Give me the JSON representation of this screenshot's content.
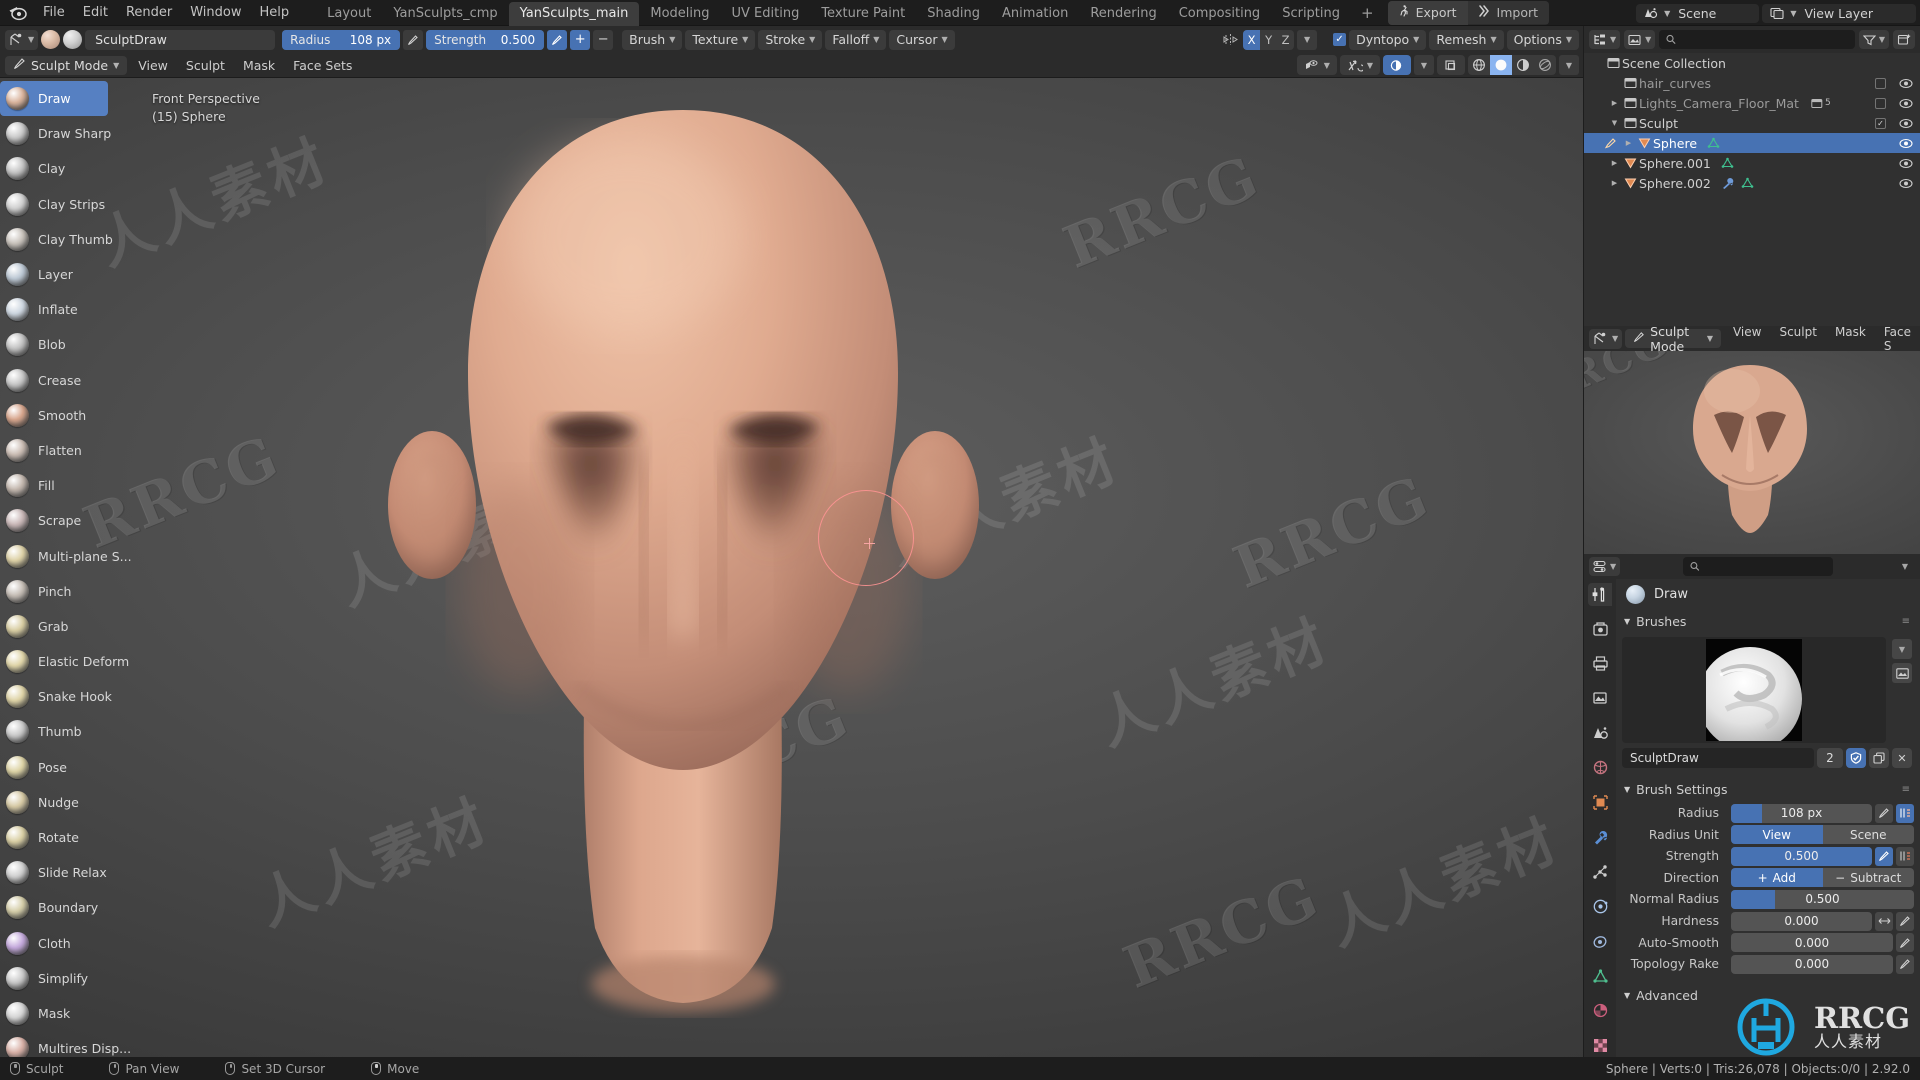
{
  "app": {
    "name": "Blender",
    "version": "2.92.0"
  },
  "topbar": {
    "menus": [
      "File",
      "Edit",
      "Render",
      "Window",
      "Help"
    ],
    "workspaces": [
      {
        "label": "Layout",
        "active": false
      },
      {
        "label": "YanSculpts_cmp",
        "active": false
      },
      {
        "label": "YanSculpts_main",
        "active": true
      },
      {
        "label": "Modeling",
        "active": false
      },
      {
        "label": "UV Editing",
        "active": false
      },
      {
        "label": "Texture Paint",
        "active": false
      },
      {
        "label": "Shading",
        "active": false
      },
      {
        "label": "Animation",
        "active": false
      },
      {
        "label": "Rendering",
        "active": false
      },
      {
        "label": "Compositing",
        "active": false
      },
      {
        "label": "Scripting",
        "active": false
      }
    ],
    "add_workspace": "+",
    "export_label": "Export",
    "import_label": "Import",
    "scene_name": "Scene",
    "view_layer_name": "View Layer"
  },
  "view3d_header": {
    "brush_name": "SculptDraw",
    "radius_label": "Radius",
    "radius_value": "108 px",
    "strength_label": "Strength",
    "strength_value": "0.500",
    "add_symbol": "+",
    "subtract_symbol": "−",
    "dropdowns": [
      "Brush",
      "Texture",
      "Stroke",
      "Falloff",
      "Cursor"
    ],
    "symmetry_axes": [
      {
        "label": "X",
        "on": true
      },
      {
        "label": "Y",
        "on": false
      },
      {
        "label": "Z",
        "on": false
      }
    ],
    "dyntopo_label": "Dyntopo",
    "dyntopo_enabled": true,
    "remesh_label": "Remesh",
    "options_label": "Options"
  },
  "tool_header": {
    "mode": "Sculpt Mode",
    "menus": [
      "View",
      "Sculpt",
      "Mask",
      "Face Sets"
    ]
  },
  "viewport": {
    "view_name": "Front Perspective",
    "object_info": "(15) Sphere",
    "tools": [
      {
        "label": "Draw",
        "active": true,
        "color": "#d9b39c"
      },
      {
        "label": "Draw Sharp",
        "active": false,
        "color": "#c9c9c9"
      },
      {
        "label": "Clay",
        "active": false,
        "color": "#c4c4c4"
      },
      {
        "label": "Clay Strips",
        "active": false,
        "color": "#cfcfcf"
      },
      {
        "label": "Clay Thumb",
        "active": false,
        "color": "#c8c2bb"
      },
      {
        "label": "Layer",
        "active": false,
        "color": "#bcc8d4"
      },
      {
        "label": "Inflate",
        "active": false,
        "color": "#cdd6e0"
      },
      {
        "label": "Blob",
        "active": false,
        "color": "#c2c2c2"
      },
      {
        "label": "Crease",
        "active": false,
        "color": "#c6c6c6"
      },
      {
        "label": "Smooth",
        "active": false,
        "color": "#d7a58c"
      },
      {
        "label": "Flatten",
        "active": false,
        "color": "#cbbdb4"
      },
      {
        "label": "Fill",
        "active": false,
        "color": "#c3b7ae"
      },
      {
        "label": "Scrape",
        "active": false,
        "color": "#c9b7b7"
      },
      {
        "label": "Multi-plane S...",
        "active": false,
        "color": "#ddd1a6"
      },
      {
        "label": "Pinch",
        "active": false,
        "color": "#c5bdb5"
      },
      {
        "label": "Grab",
        "active": false,
        "color": "#d8cda2"
      },
      {
        "label": "Elastic Deform",
        "active": false,
        "color": "#e0d5a8"
      },
      {
        "label": "Snake Hook",
        "active": false,
        "color": "#ded3a6"
      },
      {
        "label": "Thumb",
        "active": false,
        "color": "#c9c9c9"
      },
      {
        "label": "Pose",
        "active": false,
        "color": "#ddd3a5"
      },
      {
        "label": "Nudge",
        "active": false,
        "color": "#d6c9a4"
      },
      {
        "label": "Rotate",
        "active": false,
        "color": "#d9cfa4"
      },
      {
        "label": "Slide Relax",
        "active": false,
        "color": "#cfcfcf"
      },
      {
        "label": "Boundary",
        "active": false,
        "color": "#d4cda8"
      },
      {
        "label": "Cloth",
        "active": false,
        "color": "#c4a9dc"
      },
      {
        "label": "Simplify",
        "active": false,
        "color": "#c9c9c9"
      },
      {
        "label": "Mask",
        "active": false,
        "color": "#d4d4d4"
      },
      {
        "label": "Multires Disp...",
        "active": false,
        "color": "#d8b0a6"
      }
    ]
  },
  "outliner": {
    "search_placeholder": "",
    "rows": [
      {
        "name": "Scene Collection",
        "indent": 0,
        "type": "collection",
        "disclose": "",
        "selected": false,
        "checkbox": null,
        "eye": false,
        "extra": ""
      },
      {
        "name": "hair_curves",
        "indent": 1,
        "type": "collection",
        "disclose": "",
        "selected": false,
        "checkbox": false,
        "eye": true,
        "extra": ""
      },
      {
        "name": "Lights_Camera_Floor_Mat",
        "indent": 1,
        "type": "collection",
        "disclose": "▶",
        "selected": false,
        "checkbox": false,
        "eye": true,
        "extra": "5"
      },
      {
        "name": "Sculpt",
        "indent": 1,
        "type": "collection",
        "disclose": "▼",
        "selected": false,
        "checkbox": true,
        "eye": true,
        "extra": ""
      },
      {
        "name": "Sphere",
        "indent": 2,
        "type": "mesh",
        "disclose": "▶",
        "selected": true,
        "checkbox": null,
        "eye": true,
        "extra": ""
      },
      {
        "name": "Sphere.001",
        "indent": 1,
        "type": "mesh",
        "disclose": "▶",
        "selected": false,
        "checkbox": null,
        "eye": true,
        "extra": ""
      },
      {
        "name": "Sphere.002",
        "indent": 1,
        "type": "mesh",
        "disclose": "▶",
        "selected": false,
        "checkbox": null,
        "eye": true,
        "extra": ""
      }
    ]
  },
  "preview_panel": {
    "mode": "Sculpt Mode",
    "menus": [
      "View",
      "Sculpt",
      "Mask",
      "Face S"
    ]
  },
  "properties": {
    "search_placeholder": "",
    "brush_title": "Draw",
    "brushes_panel": "Brushes",
    "brush_name": "SculptDraw",
    "brush_users": "2",
    "brush_settings_panel": "Brush Settings",
    "advanced_panel": "Advanced",
    "fields": [
      {
        "label": "Radius",
        "value": "108 px",
        "type": "slider",
        "fill": 0.22,
        "icons": [
          "brush",
          "blue-anim"
        ]
      },
      {
        "label": "Radius Unit",
        "type": "segment",
        "options": [
          "View",
          "Scene"
        ],
        "selected": 0
      },
      {
        "label": "Strength",
        "value": "0.500",
        "type": "slider",
        "fill": 1.0,
        "icons": [
          "brush-blue",
          "anim"
        ]
      },
      {
        "label": "Direction",
        "type": "segment",
        "options": [
          "Add",
          "Subtract"
        ],
        "selected": 0,
        "prefixes": [
          "+",
          "−"
        ]
      },
      {
        "label": "Normal Radius",
        "value": "0.500",
        "type": "slider",
        "fill": 0.24,
        "icons": []
      },
      {
        "label": "Hardness",
        "value": "0.000",
        "type": "slider",
        "fill": 0.0,
        "icons": [
          "arrows",
          "brush"
        ]
      },
      {
        "label": "Auto-Smooth",
        "value": "0.000",
        "type": "slider",
        "fill": 0.0,
        "icons": [
          "brush"
        ]
      },
      {
        "label": "Topology Rake",
        "value": "0.000",
        "type": "slider",
        "fill": 0.0,
        "icons": [
          "brush"
        ]
      }
    ]
  },
  "statusbar": {
    "items": [
      {
        "label": "Sculpt",
        "icon": "mouse-left"
      },
      {
        "label": "Pan View",
        "icon": "mouse-middle"
      },
      {
        "label": "Set 3D Cursor",
        "icon": "mouse-left"
      },
      {
        "label": "Move",
        "icon": "mouse-right"
      }
    ],
    "stats": "Sphere | Verts:0 | Tris:26,078 | Objects:0/0 | 2.92.0"
  },
  "watermarks": {
    "latin": "RRCG",
    "cjk": "人人素材"
  },
  "colors": {
    "accent_blue": "#4772b3",
    "select_blue": "#5680c2",
    "panel_bg": "#303030",
    "header_bg": "#2b2b2b",
    "topbar_bg": "#1d1d1d",
    "skin": "#dcab92",
    "brush_cursor": "#ff9494"
  }
}
